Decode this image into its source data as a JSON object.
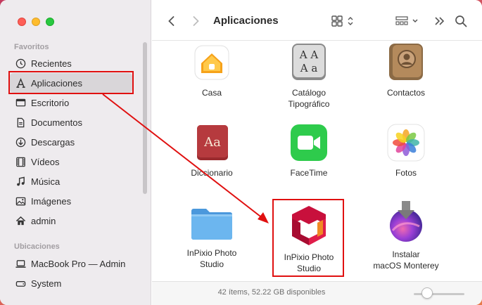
{
  "window": {
    "traffic_lights": [
      "close",
      "minimize",
      "zoom"
    ]
  },
  "sidebar": {
    "favorites_title": "Favoritos",
    "favorites": [
      {
        "label": "Recientes",
        "icon": "clock-icon"
      },
      {
        "label": "Aplicaciones",
        "icon": "applications-icon",
        "selected": true
      },
      {
        "label": "Escritorio",
        "icon": "desktop-icon"
      },
      {
        "label": "Documentos",
        "icon": "document-icon"
      },
      {
        "label": "Descargas",
        "icon": "download-icon"
      },
      {
        "label": "Vídeos",
        "icon": "film-icon"
      },
      {
        "label": "Música",
        "icon": "music-note-icon"
      },
      {
        "label": "Imágenes",
        "icon": "photo-icon"
      },
      {
        "label": "admin",
        "icon": "home-icon"
      }
    ],
    "locations_title": "Ubicaciones",
    "locations": [
      {
        "label": "MacBook Pro — Admin",
        "icon": "laptop-icon"
      },
      {
        "label": "System",
        "icon": "disk-icon"
      }
    ]
  },
  "toolbar": {
    "title": "Aplicaciones",
    "back": "chevron-left-icon",
    "forward": "chevron-right-icon",
    "view": "grid-view-icon",
    "group": "group-by-icon",
    "more": "double-chevron-icon",
    "search": "search-icon"
  },
  "apps": [
    {
      "label": "Casa",
      "icon": "home-app-icon"
    },
    {
      "label": "Catálogo\nTipográfico",
      "icon": "font-book-icon"
    },
    {
      "label": "Contactos",
      "icon": "contacts-icon"
    },
    {
      "label": "Diccionario",
      "icon": "dictionary-icon"
    },
    {
      "label": "FaceTime",
      "icon": "facetime-icon"
    },
    {
      "label": "Fotos",
      "icon": "photos-icon"
    },
    {
      "label": "InPixio Photo\nStudio",
      "icon": "folder-icon"
    },
    {
      "label": "InPixio Photo\nStudio",
      "icon": "inpixio-icon"
    },
    {
      "label": "Instalar\nmacOS Monterey",
      "icon": "macos-installer-icon"
    }
  ],
  "icon_glyphs": {
    "font_book": "AA\nAa",
    "dictionary": "Aa"
  },
  "status": {
    "text": "42 ítems, 52.22 GB disponibles",
    "zoom": 0.2
  },
  "colors": {
    "highlight": "#e01010",
    "folder_blue": "#5aa8e8",
    "inpixio_red": "#c8103c",
    "inpixio_orange": "#f08a24"
  }
}
